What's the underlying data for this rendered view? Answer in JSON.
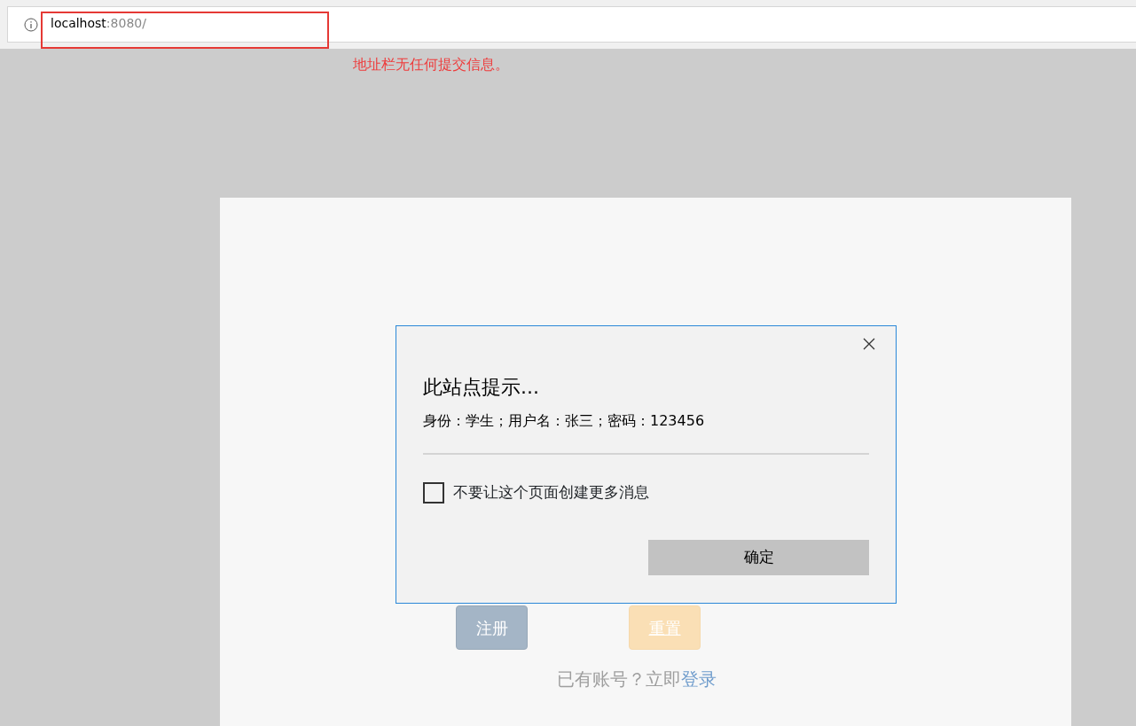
{
  "browser": {
    "address": {
      "host": "localhost",
      "rest": ":8080/"
    },
    "highlight_box": true
  },
  "annotation": {
    "text": "地址栏无任何提交信息。"
  },
  "page": {
    "buttons": [
      {
        "label": "注册",
        "kind": "primary"
      },
      {
        "label": "重置",
        "kind": "warning"
      }
    ],
    "login_prompt": {
      "text": "已有账号？立即",
      "link": "登录"
    }
  },
  "dialog": {
    "title": "此站点提示...",
    "message": "身份：学生；用户名：张三；密码：123456",
    "checkbox": {
      "label": "不要让这个页面创建更多消息",
      "checked": false
    },
    "ok_button": "确定"
  }
}
